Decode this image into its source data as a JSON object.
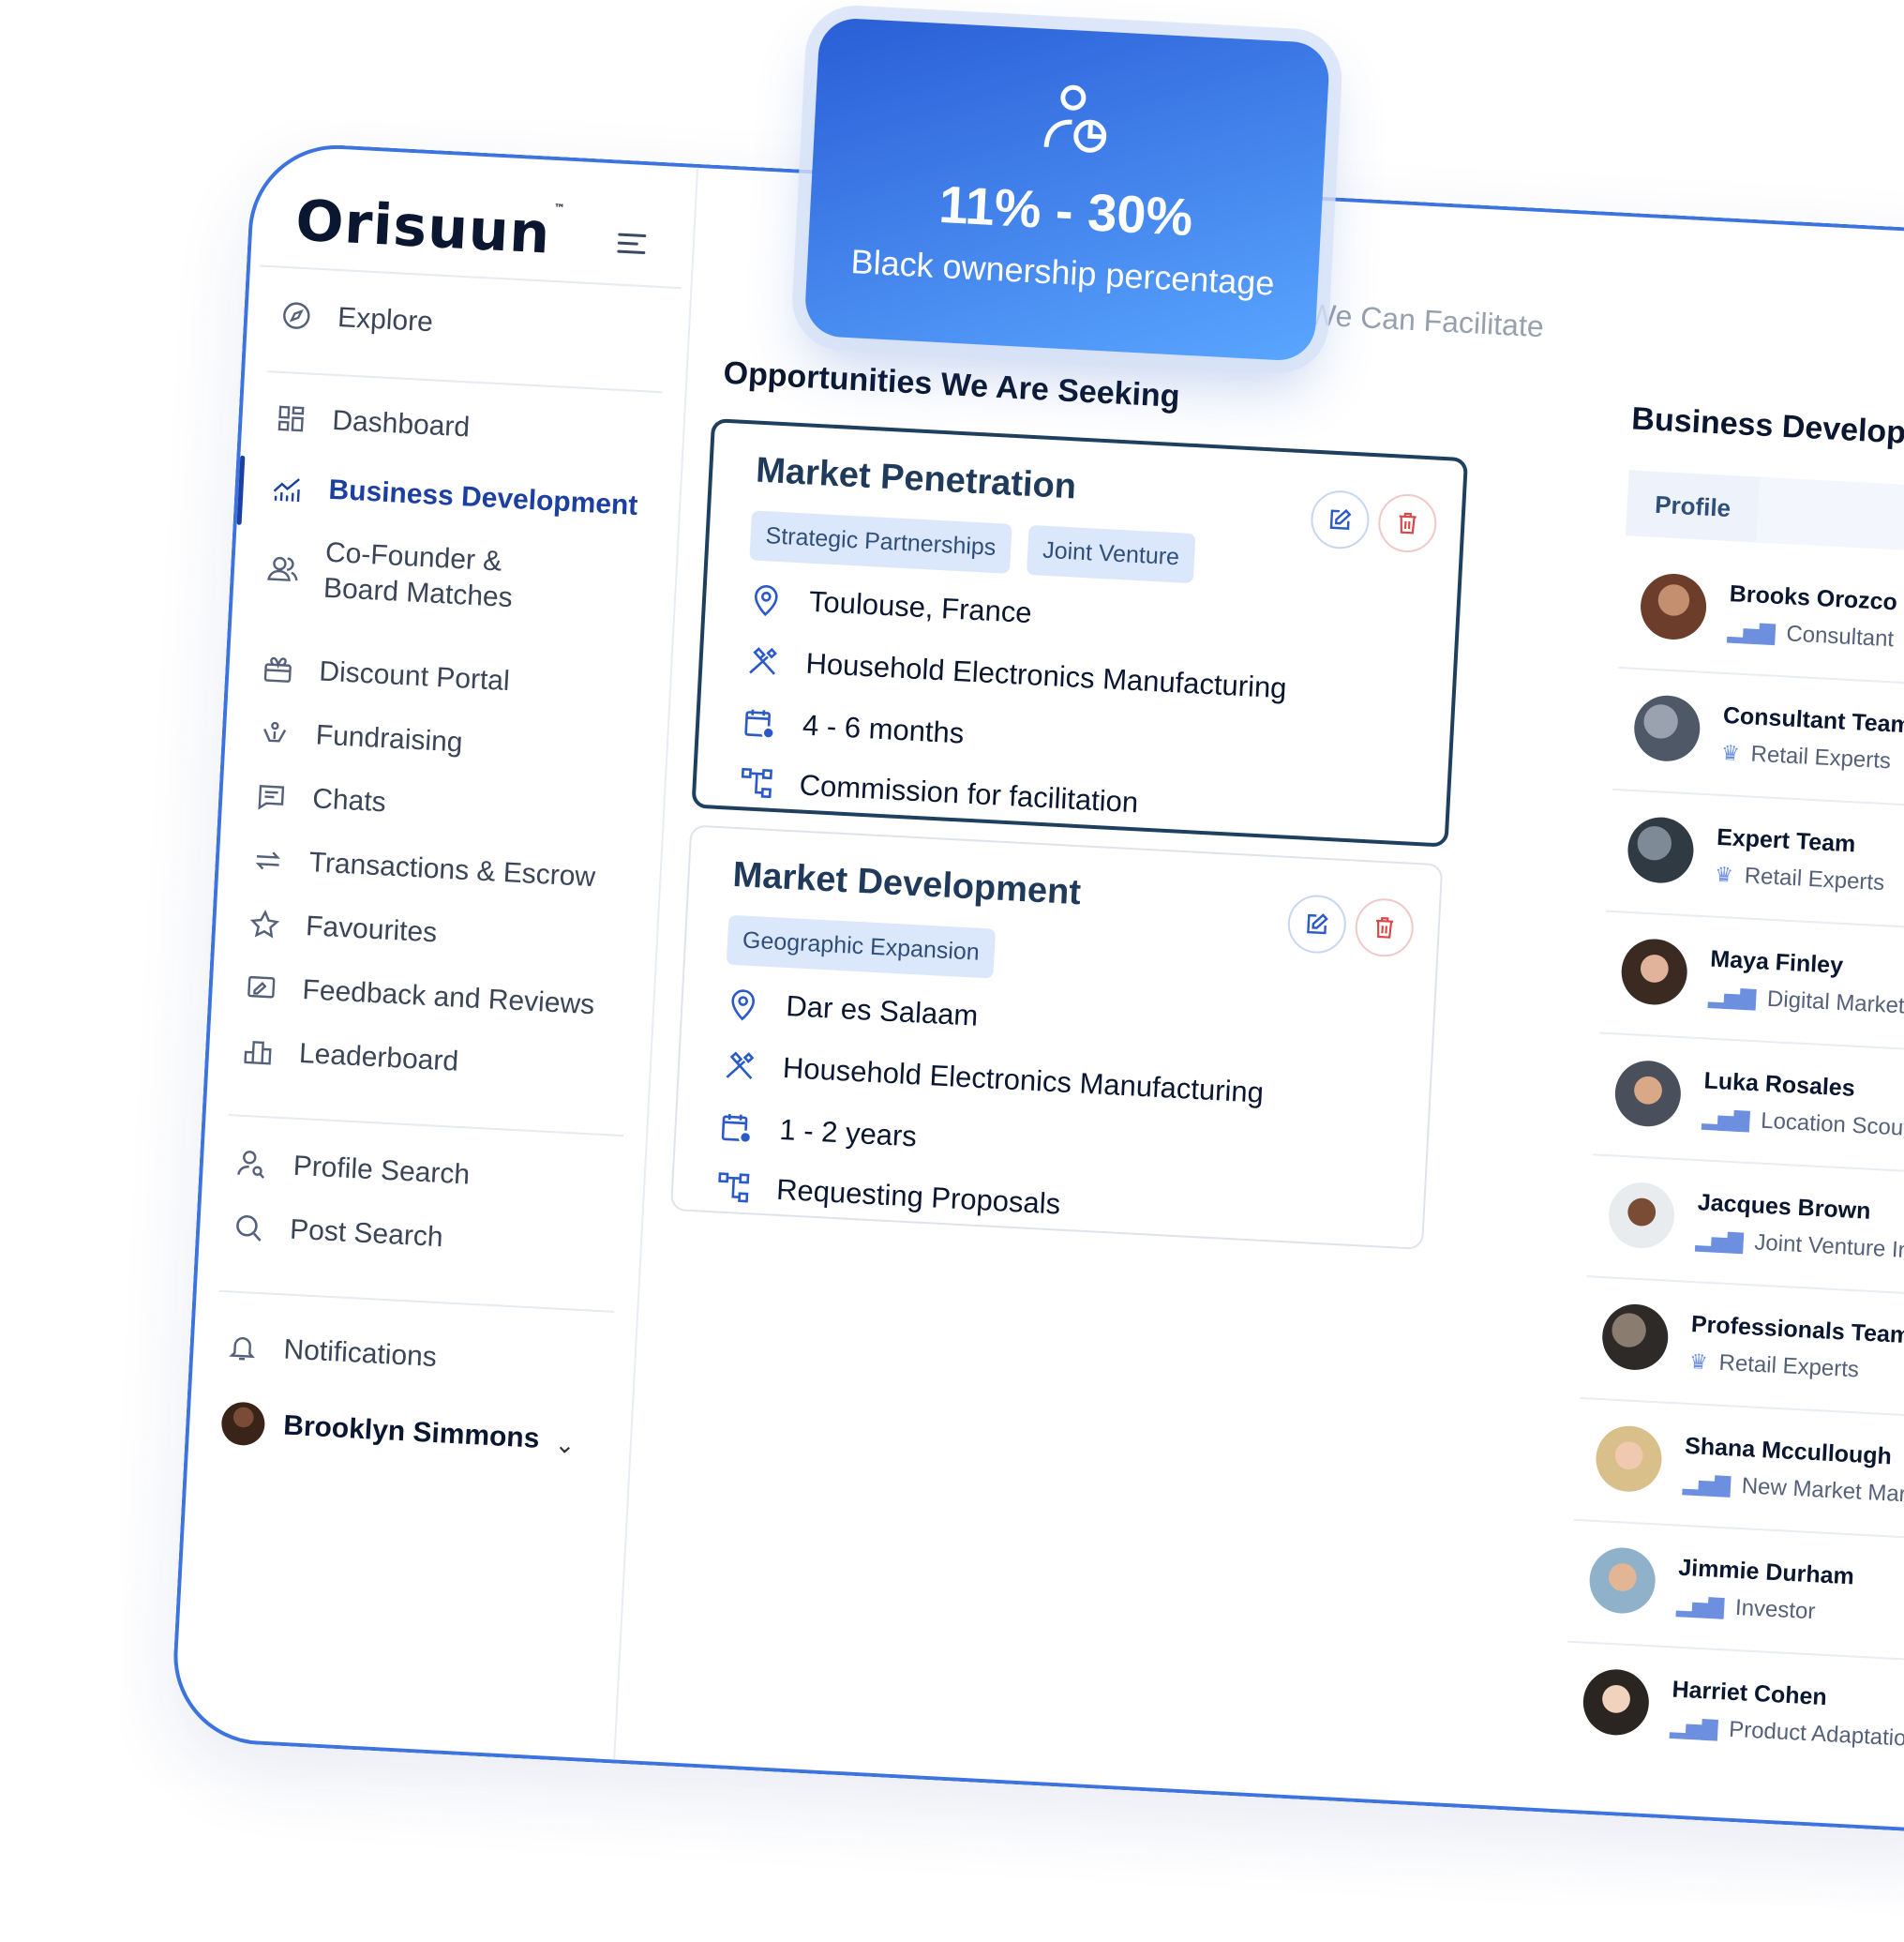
{
  "brand": {
    "name": "Orisuun",
    "tm": "™"
  },
  "stat_card": {
    "value": "11% - 30%",
    "label": "Black ownership percentage"
  },
  "sidebar": {
    "explore": "Explore",
    "items": [
      {
        "label": "Dashboard",
        "icon": "grid-icon"
      },
      {
        "label": "Business Development",
        "icon": "chart-icon",
        "active": true
      },
      {
        "label": "Co-Founder & Board Matches",
        "icon": "users-icon"
      },
      {
        "label": "Discount Portal",
        "icon": "gift-icon"
      },
      {
        "label": "Fundraising",
        "icon": "fundraising-icon"
      },
      {
        "label": "Chats",
        "icon": "chat-icon"
      },
      {
        "label": "Transactions & Escrow",
        "icon": "swap-icon"
      },
      {
        "label": "Favourites",
        "icon": "star-icon"
      },
      {
        "label": "Feedback and Reviews",
        "icon": "feedback-icon"
      },
      {
        "label": "Leaderboard",
        "icon": "podium-icon"
      }
    ],
    "search": [
      {
        "label": "Profile Search",
        "icon": "profile-search-icon"
      },
      {
        "label": "Post Search",
        "icon": "search-icon"
      }
    ],
    "notifications": "Notifications",
    "user": "Brooklyn Simmons"
  },
  "main": {
    "seeking_title": "Opportunities We Are Seeking",
    "facilitate_title": "Opportunities We Can Facilitate",
    "cards": [
      {
        "title": "Market Penetration",
        "tags": [
          "Strategic Partnerships",
          "Joint Venture"
        ],
        "location": "Toulouse, France",
        "industry": "Household Electronics Manufacturing",
        "duration": "4 - 6 months",
        "terms": "Commission for facilitation"
      },
      {
        "title": "Market Development",
        "tags": [
          "Geographic Expansion"
        ],
        "location": "Dar es Salaam",
        "industry": "Household Electronics Manufacturing",
        "duration": "1 - 2 years",
        "terms": "Requesting Proposals"
      }
    ]
  },
  "right_panel": {
    "title": "Business Development C",
    "tab": "Profile",
    "people": [
      {
        "name": "Brooks Orozco",
        "role": "Consultant"
      },
      {
        "name": "Consultant Team",
        "role": "Retail Experts"
      },
      {
        "name": "Expert Team",
        "role": "Retail Experts"
      },
      {
        "name": "Maya Finley",
        "role": "Digital Marketing"
      },
      {
        "name": "Luka Rosales",
        "role": "Location Scouting"
      },
      {
        "name": "Jacques Brown",
        "role": "Joint Venture Integration"
      },
      {
        "name": "Professionals Team",
        "role": "Retail Experts"
      },
      {
        "name": "Shana Mccullough",
        "role": "New Market Marketing"
      },
      {
        "name": "Jimmie Durham",
        "role": "Investor"
      },
      {
        "name": "Harriet Cohen",
        "role": "Product Adaptation"
      }
    ]
  }
}
